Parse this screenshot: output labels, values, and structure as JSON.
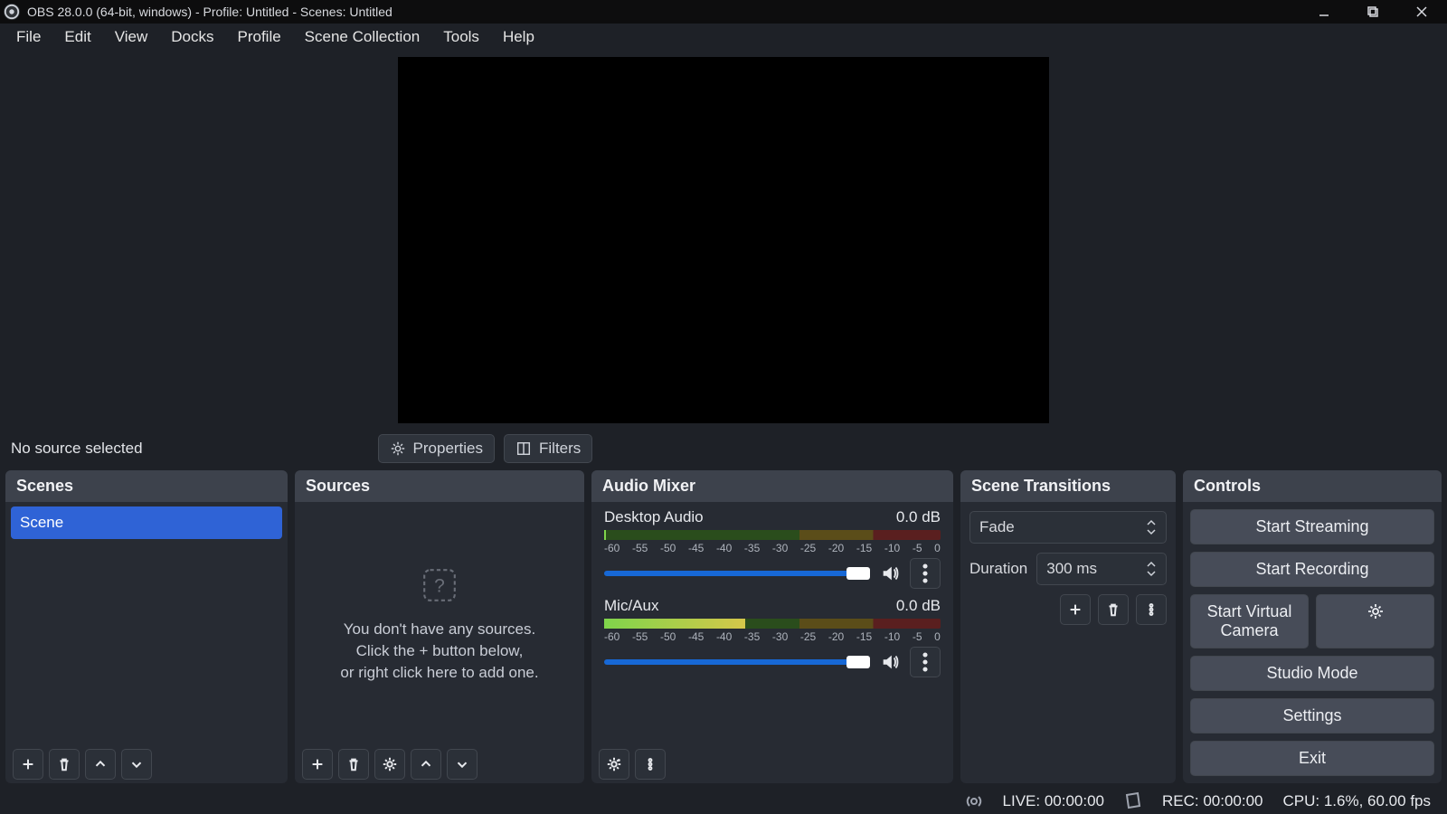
{
  "title": "OBS 28.0.0 (64-bit, windows) - Profile: Untitled - Scenes: Untitled",
  "menu": [
    "File",
    "Edit",
    "View",
    "Docks",
    "Profile",
    "Scene Collection",
    "Tools",
    "Help"
  ],
  "sourceInfo": {
    "noSource": "No source selected",
    "properties": "Properties",
    "filters": "Filters"
  },
  "panels": {
    "scenes": {
      "title": "Scenes",
      "items": [
        "Scene"
      ]
    },
    "sources": {
      "title": "Sources",
      "emptyL1": "You don't have any sources.",
      "emptyL2": "Click the + button below,",
      "emptyL3": "or right click here to add one."
    },
    "mixer": {
      "title": "Audio Mixer",
      "ticks": [
        "-60",
        "-55",
        "-50",
        "-45",
        "-40",
        "-35",
        "-30",
        "-25",
        "-20",
        "-15",
        "-10",
        "-5",
        "0"
      ],
      "ch1": {
        "name": "Desktop Audio",
        "db": "0.0 dB"
      },
      "ch2": {
        "name": "Mic/Aux",
        "db": "0.0 dB"
      }
    },
    "transitions": {
      "title": "Scene Transitions",
      "current": "Fade",
      "durationLabel": "Duration",
      "duration": "300 ms"
    },
    "controls": {
      "title": "Controls",
      "startStreaming": "Start Streaming",
      "startRecording": "Start Recording",
      "startVirtualCam": "Start Virtual Camera",
      "studioMode": "Studio Mode",
      "settings": "Settings",
      "exit": "Exit"
    }
  },
  "status": {
    "live": "LIVE: 00:00:00",
    "rec": "REC: 00:00:00",
    "cpu": "CPU: 1.6%, 60.00 fps"
  }
}
